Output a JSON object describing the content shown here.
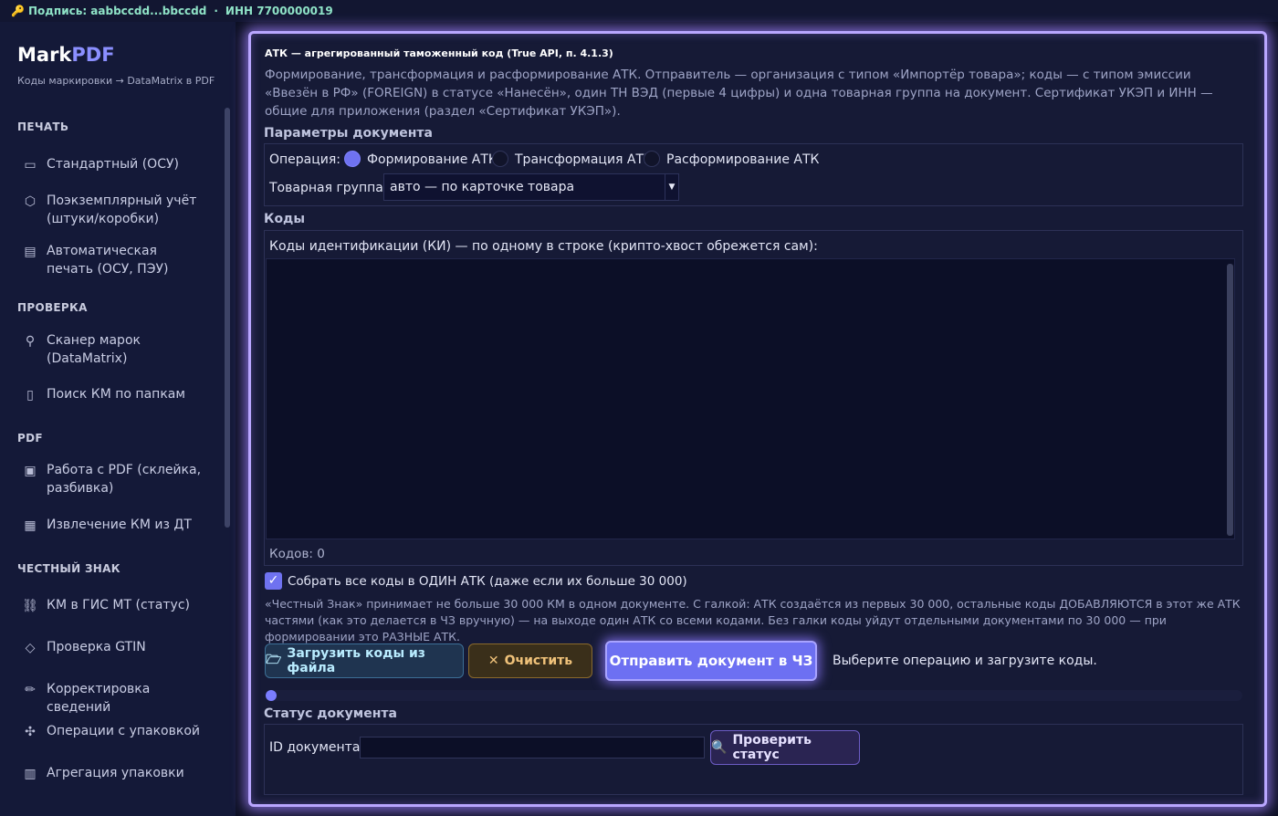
{
  "topbar": {
    "signature": "Подпись: aabbccdd...bbccdd",
    "separator": "·",
    "inn": "ИНН 7700000019"
  },
  "sidebar": {
    "brand_main": "Mark",
    "brand_accent": "PDF",
    "subtitle": "Коды маркировки → DataMatrix в PDF",
    "sections": [
      {
        "title": "ПЕЧАТЬ",
        "items": [
          {
            "icon": "document-icon",
            "label": "Стандартный (ОСУ)"
          },
          {
            "icon": "box-icon",
            "label": "Поэкземплярный учёт (штуки/коробки)"
          },
          {
            "icon": "calendar-icon",
            "label": "Автоматическая печать (ОСУ, ПЭУ)"
          }
        ]
      },
      {
        "title": "ПРОВЕРКА",
        "items": [
          {
            "icon": "magnifier-icon",
            "label": "Сканер марок (DataMatrix)"
          },
          {
            "icon": "phone-icon",
            "label": "Поиск КМ по папкам"
          }
        ]
      },
      {
        "title": "PDF",
        "items": [
          {
            "icon": "briefcase-icon",
            "label": "Работа с PDF (склейка, разбивка)"
          },
          {
            "icon": "clipboard-icon",
            "label": "Извлечение КМ из ДТ"
          }
        ]
      },
      {
        "title": "ЧЕСТНЫЙ ЗНАК",
        "items": [
          {
            "icon": "link-icon",
            "label": "КМ в ГИС МТ (статус)"
          },
          {
            "icon": "tag-icon",
            "label": "Проверка GTIN"
          },
          {
            "icon": "pencil-icon",
            "label": "Корректировка сведений"
          },
          {
            "icon": "puzzle-icon",
            "label": "Операции с упаковкой"
          },
          {
            "icon": "grid-icon",
            "label": "Агрегация упаковки"
          }
        ]
      }
    ]
  },
  "main": {
    "title": "АТК — агрегированный таможенный код (True API, п. 4.1.3)",
    "description": "Формирование, трансформация и расформирование АТК. Отправитель — организация с типом «Импортёр товара»; коды — с типом эмиссии «Ввезён в РФ» (FOREIGN) в статусе «Нанесён», один ТН ВЭД (первые 4 цифры) и одна товарная группа на документ. Сертификат УКЭП и ИНН — общие для приложения (раздел «Сертификат УКЭП»).",
    "params": {
      "title": "Параметры документа",
      "operation_label": "Операция:",
      "operations": [
        "Формирование АТК",
        "Трансформация АТК",
        "Расформирование АТК"
      ],
      "selected_operation": "Формирование АТК",
      "group_label": "Товарная группа:",
      "group_value": "авто — по карточке товара"
    },
    "codes": {
      "title": "Коды",
      "label": "Коды идентификации (КИ) — по одному в строке (крипто-хвост обрежется сам):",
      "value": "",
      "count_text": "Кодов: 0"
    },
    "single_atk": {
      "checked": true,
      "label": "Собрать все коды в ОДИН АТК (даже если их больше 30 000)",
      "hint": "«Честный Знак» принимает не больше 30 000 КМ в одном документе. С галкой: АТК создаётся из первых 30 000, остальные коды ДОБАВЛЯЮТСЯ в этот же АТК частями (как это делается в ЧЗ вручную) — на выходе один АТК со всеми кодами. Без галки коды уйдут отдельными документами по 30 000 — при формировании это РАЗНЫЕ АТК."
    },
    "actions": {
      "load_label": "Загрузить коды из файла",
      "clear_label": "Очистить",
      "send_label": "Отправить документ в ЧЗ",
      "status_message": "Выберите операцию и загрузите коды.",
      "progress": 0
    },
    "status": {
      "title": "Статус документа",
      "id_label": "ID документа:",
      "id_value": "",
      "check_label": "Проверить статус"
    }
  }
}
